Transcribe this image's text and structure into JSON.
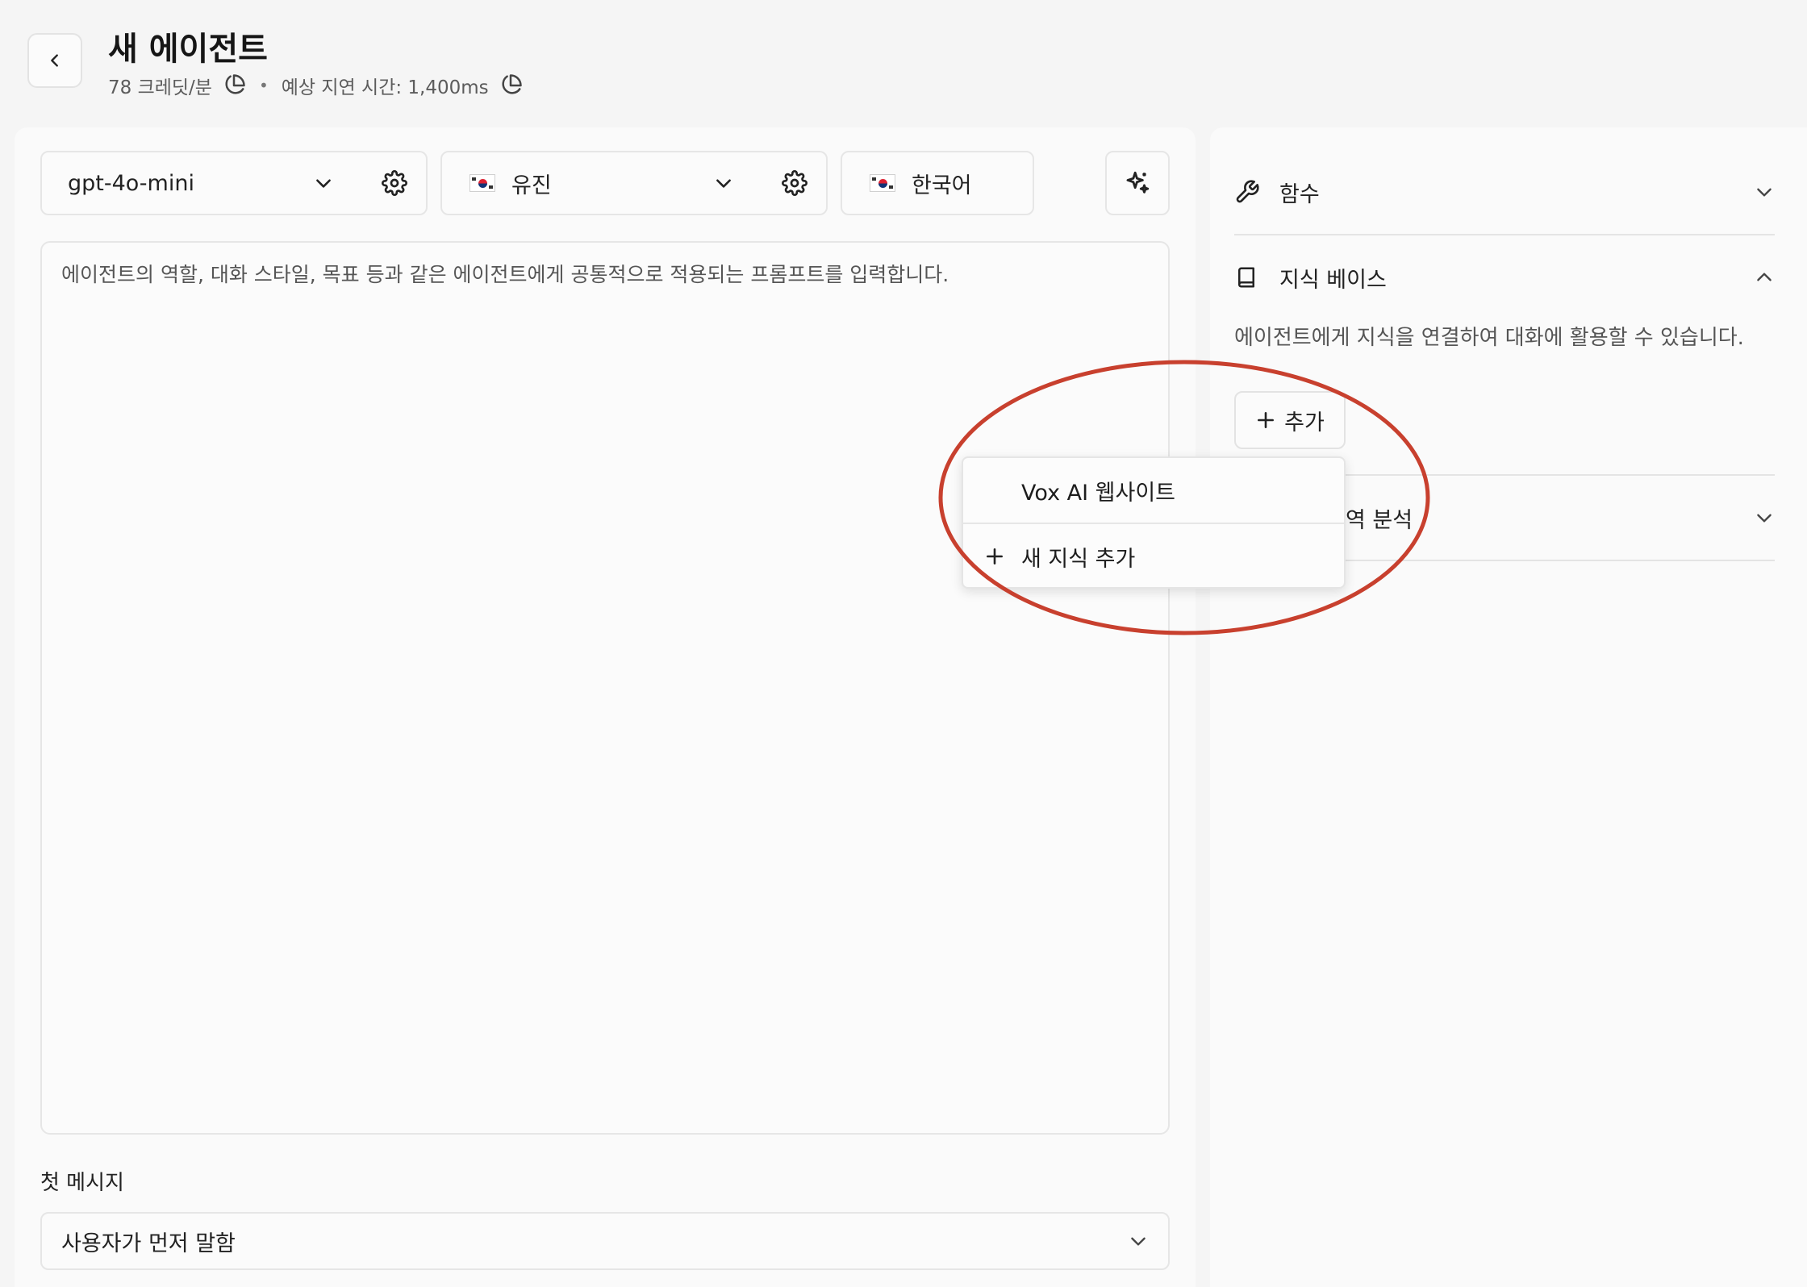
{
  "header": {
    "title": "새 에이전트",
    "credits": "78 크레딧/분",
    "latency": "예상 지연 시간: 1,400ms"
  },
  "toolbar": {
    "model": "gpt-4o-mini",
    "voice": "유진",
    "language": "한국어"
  },
  "prompt": {
    "placeholder": "에이전트의 역할, 대화 스타일, 목표 등과 같은 에이전트에게 공통적으로 적용되는 프롬프트를 입력합니다."
  },
  "first_message": {
    "label": "첫 메시지",
    "value": "사용자가 먼저 말함"
  },
  "right": {
    "functions": {
      "title": "함수"
    },
    "knowledge": {
      "title": "지식 베이스",
      "description": "에이전트에게 지식을 연결하여 대화에 활용할 수 있습니다.",
      "add_label": "추가"
    },
    "third_section_partial": "역 분석"
  },
  "menu": {
    "items": [
      "Vox AI 웹사이트",
      "새 지식 추가"
    ]
  },
  "colors": {
    "annotation": "#c8402e",
    "background": "#f5f5f5",
    "panel": "#fafafa",
    "border": "#e6e6e6"
  }
}
